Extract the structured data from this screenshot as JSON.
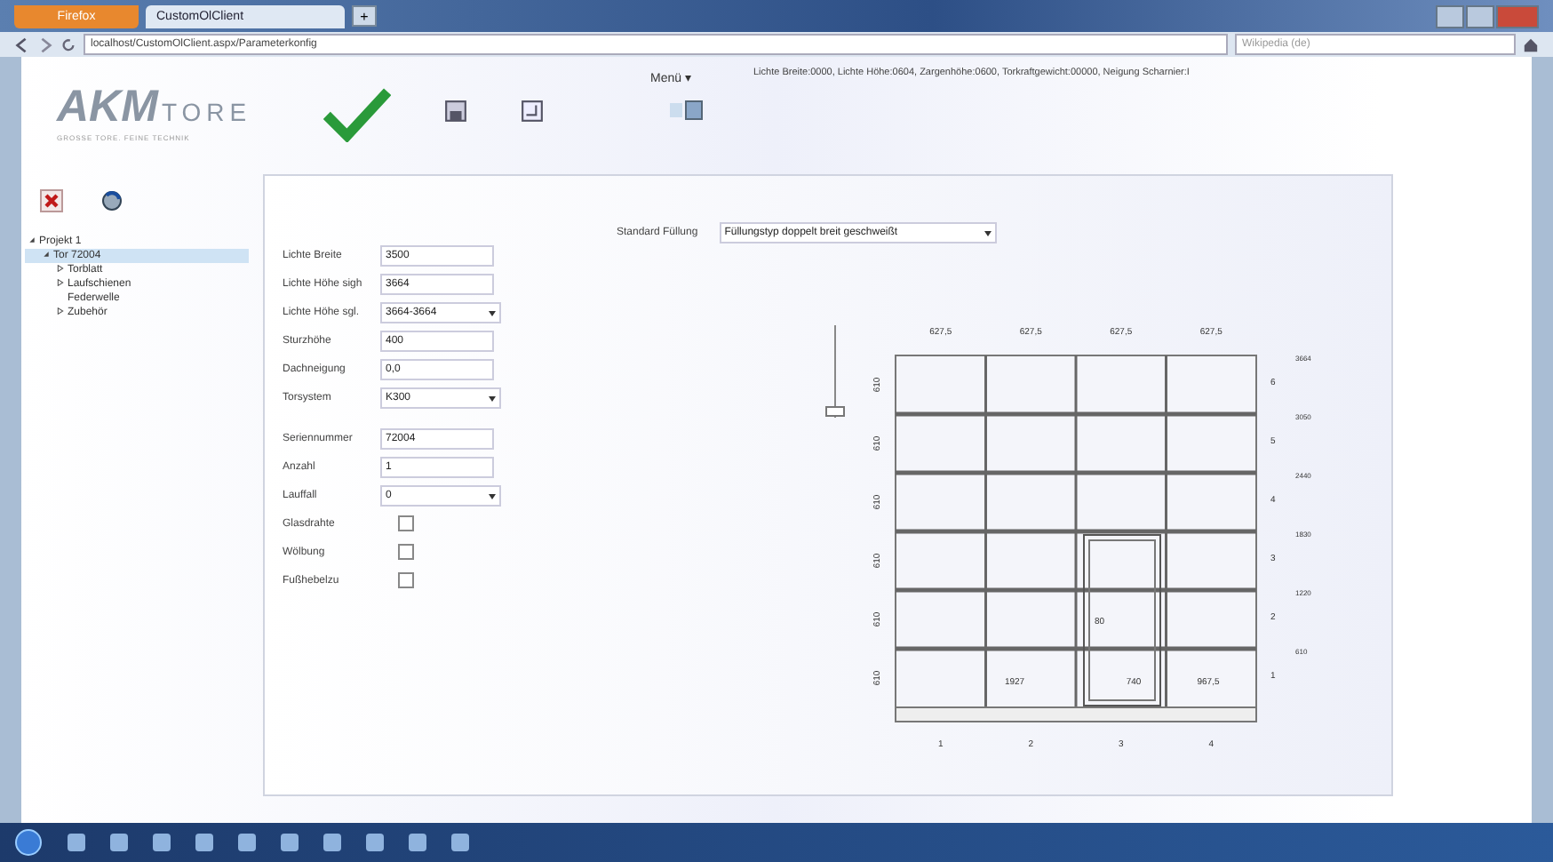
{
  "browser": {
    "app_button": "Firefox",
    "tab_title": "CustomOlClient",
    "new_tab": "+",
    "url": "localhost/CustomOlClient.aspx/Parameterkonfig",
    "search_placeholder": "Wikipedia (de)"
  },
  "header": {
    "logo_mark": "AKM",
    "logo_word": "TORE",
    "tagline": "GROSSE TORE. FEINE TECHNIK",
    "menu_label": "Menü",
    "menu_caret": "▾",
    "info": "Lichte Breite:0000, Lichte Höhe:0604, Zargenhöhe:0600, Torkraftgewicht:00000, Neigung Scharnier:I"
  },
  "tree": [
    {
      "label": "Projekt 1",
      "expanded": true,
      "selected": false,
      "children": [
        {
          "label": "Tor 72004",
          "expanded": true,
          "selected": true,
          "children": [
            {
              "label": "Torblatt",
              "expanded": false,
              "selected": false
            },
            {
              "label": "Laufschienen",
              "expanded": false,
              "selected": false
            },
            {
              "label": "Federwelle",
              "selected": false
            },
            {
              "label": "Zubehör",
              "expanded": false,
              "selected": false
            }
          ]
        }
      ]
    }
  ],
  "form": [
    [
      {
        "kind": "text",
        "label": "Lichte Breite",
        "value": "3500"
      },
      {
        "kind": "text",
        "label": "Lichte Höhe sigh",
        "value": "3664"
      },
      {
        "kind": "select",
        "label": "Lichte Höhe sgl.",
        "value": "3664-3664"
      },
      {
        "kind": "text",
        "label": "Sturzhöhe",
        "value": "400"
      },
      {
        "kind": "text",
        "label": "Dachneigung",
        "value": "0,0"
      },
      {
        "kind": "select",
        "label": "Torsystem",
        "value": "K300"
      }
    ],
    [
      {
        "kind": "text",
        "label": "Seriennummer",
        "value": "72004"
      },
      {
        "kind": "text",
        "label": "Anzahl",
        "value": "1"
      },
      {
        "kind": "select",
        "label": "Lauffall",
        "value": "0"
      },
      {
        "kind": "checkbox",
        "label": "Glasdrahte",
        "checked": false
      },
      {
        "kind": "checkbox",
        "label": "Wölbung",
        "checked": false
      },
      {
        "kind": "checkbox",
        "label": "Fußhebelzu",
        "checked": false
      }
    ]
  ],
  "filling": {
    "label": "Standard Füllung",
    "value": "Füllungstyp doppelt breit geschweißt"
  },
  "zoom_slider": {
    "level": 0
  },
  "drawing": {
    "top_dims": [
      "627,5",
      "627,5",
      "627,5",
      "627,5"
    ],
    "left_dims": [
      "610",
      "610",
      "610",
      "610",
      "610",
      "610"
    ],
    "row_numbers": [
      "6",
      "5",
      "4",
      "3",
      "2",
      "1"
    ],
    "right_dims": [
      "3664",
      "3050",
      "2440",
      "1830",
      "1220",
      "610"
    ],
    "bottom_labels": [
      "1",
      "2",
      "3",
      "4"
    ],
    "inner_labels": [
      "1927",
      "740",
      "967,5",
      "80"
    ]
  }
}
